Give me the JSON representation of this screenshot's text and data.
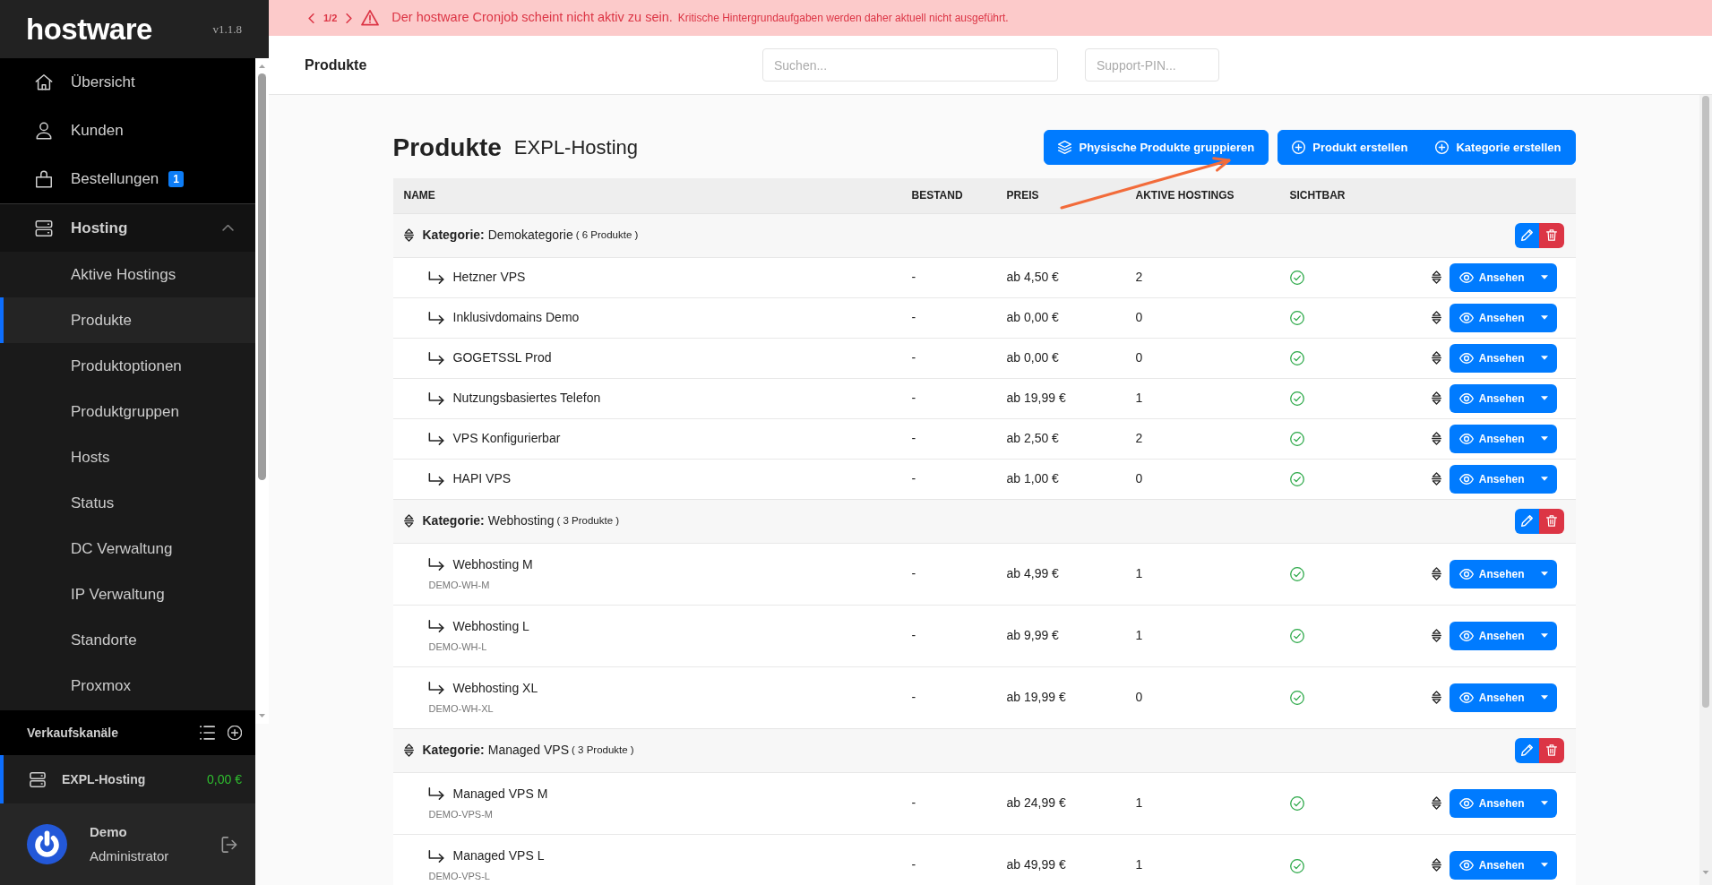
{
  "sidebar": {
    "logo": "hostware",
    "version": "v1.1.8",
    "nav": [
      {
        "label": "Übersicht",
        "selected": false
      },
      {
        "label": "Kunden",
        "selected": false
      },
      {
        "label": "Bestellungen",
        "badge": "1",
        "selected": false
      },
      {
        "label": "Hosting",
        "selected": false,
        "expanded": true,
        "children": [
          {
            "label": "Aktive Hostings",
            "selected": false
          },
          {
            "label": "Produkte",
            "selected": true
          },
          {
            "label": "Produktoptionen",
            "selected": false
          },
          {
            "label": "Produktgruppen",
            "selected": false
          },
          {
            "label": "Hosts",
            "selected": false
          },
          {
            "label": "Status",
            "selected": false
          },
          {
            "label": "DC Verwaltung",
            "selected": false
          },
          {
            "label": "IP Verwaltung",
            "selected": false
          },
          {
            "label": "Standorte",
            "selected": false
          },
          {
            "label": "Proxmox",
            "selected": false
          }
        ]
      }
    ],
    "channels_title": "Verkaufskanäle",
    "channels": [
      {
        "name": "EXPL-Hosting",
        "balance": "0,00 €",
        "selected": true
      }
    ],
    "user": {
      "name": "Demo",
      "role": "Administrator"
    }
  },
  "alert": {
    "pager": "1/2",
    "title": "Der hostware Cronjob scheint nicht aktiv zu sein.",
    "detail": "Kritische Hintergrundaufgaben werden daher aktuell nicht ausgeführt."
  },
  "topbar": {
    "title": "Produkte",
    "search": {
      "placeholder": "Suchen..."
    },
    "support_pin": {
      "placeholder": "Support-PIN..."
    }
  },
  "page": {
    "title": "Produkte",
    "subtitle": "EXPL-Hosting",
    "actions": [
      {
        "label": "Physische Produkte gruppieren"
      }
    ],
    "create_buttons": [
      {
        "label": "Produkt erstellen"
      },
      {
        "label": "Kategorie erstellen"
      }
    ]
  },
  "table": {
    "columns": [
      "NAME",
      "BESTAND",
      "PREIS",
      "AKTIVE HOSTINGS",
      "SICHTBAR"
    ],
    "categories": [
      {
        "label": "Kategorie:",
        "name": "Demokategorie",
        "count": "( 6 Produkte )",
        "products": [
          {
            "name": "Hetzner VPS",
            "stock": "-",
            "price": "ab 4,50 €",
            "active_hostings": "2",
            "visible": true,
            "action": "Ansehen"
          },
          {
            "name": "Inklusivdomains Demo",
            "stock": "-",
            "price": "ab 0,00 €",
            "active_hostings": "0",
            "visible": true,
            "action": "Ansehen"
          },
          {
            "name": "GOGETSSL Prod",
            "stock": "-",
            "price": "ab 0,00 €",
            "active_hostings": "0",
            "visible": true,
            "action": "Ansehen"
          },
          {
            "name": "Nutzungsbasiertes Telefon",
            "stock": "-",
            "price": "ab 19,99 €",
            "active_hostings": "1",
            "visible": true,
            "action": "Ansehen"
          },
          {
            "name": "VPS Konfigurierbar",
            "stock": "-",
            "price": "ab 2,50 €",
            "active_hostings": "2",
            "visible": true,
            "action": "Ansehen"
          },
          {
            "name": "HAPI VPS",
            "stock": "-",
            "price": "ab 1,00 €",
            "active_hostings": "0",
            "visible": true,
            "action": "Ansehen"
          }
        ]
      },
      {
        "label": "Kategorie:",
        "name": "Webhosting",
        "count": "( 3 Produkte )",
        "products": [
          {
            "name": "Webhosting M",
            "sku": "DEMO-WH-M",
            "stock": "-",
            "price": "ab 4,99 €",
            "active_hostings": "1",
            "visible": true,
            "action": "Ansehen"
          },
          {
            "name": "Webhosting L",
            "sku": "DEMO-WH-L",
            "stock": "-",
            "price": "ab 9,99 €",
            "active_hostings": "1",
            "visible": true,
            "action": "Ansehen"
          },
          {
            "name": "Webhosting XL",
            "sku": "DEMO-WH-XL",
            "stock": "-",
            "price": "ab 19,99 €",
            "active_hostings": "0",
            "visible": true,
            "action": "Ansehen"
          }
        ]
      },
      {
        "label": "Kategorie:",
        "name": "Managed VPS",
        "count": "( 3 Produkte )",
        "products": [
          {
            "name": "Managed VPS M",
            "sku": "DEMO-VPS-M",
            "stock": "-",
            "price": "ab 24,99 €",
            "active_hostings": "1",
            "visible": true,
            "action": "Ansehen"
          },
          {
            "name": "Managed VPS L",
            "sku": "DEMO-VPS-L",
            "stock": "-",
            "price": "ab 49,99 €",
            "active_hostings": "1",
            "visible": true,
            "action": "Ansehen"
          }
        ]
      }
    ]
  }
}
